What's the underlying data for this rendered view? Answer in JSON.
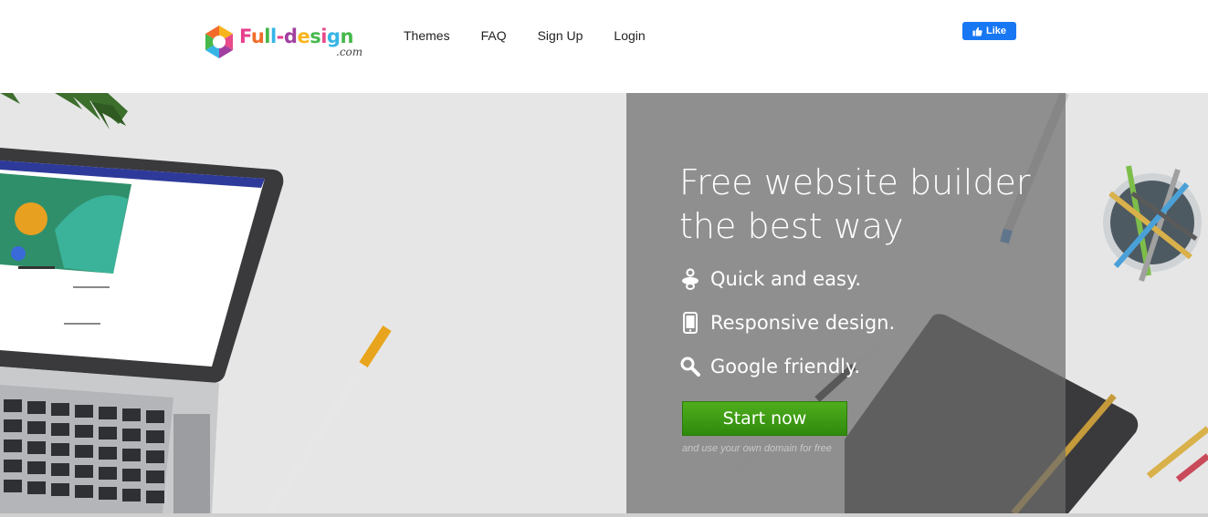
{
  "brand": {
    "name": "Full-design",
    "suffix": ".com"
  },
  "nav": {
    "items": [
      "Themes",
      "FAQ",
      "Sign Up",
      "Login"
    ]
  },
  "social": {
    "like_label": "Like"
  },
  "hero": {
    "headline_line1": "Free website builder",
    "headline_line2": "the best way",
    "features": [
      {
        "icon": "baby-pacifier-icon",
        "label": "Quick and easy."
      },
      {
        "icon": "mobile-phone-icon",
        "label": "Responsive design."
      },
      {
        "icon": "search-icon",
        "label": "Google friendly."
      }
    ],
    "cta_label": "Start now",
    "cta_note": "and use your own domain for free"
  },
  "colors": {
    "cta_green": "#3f9e15",
    "facebook_blue": "#1877f2",
    "panel_gray": "#8a8a8a"
  }
}
